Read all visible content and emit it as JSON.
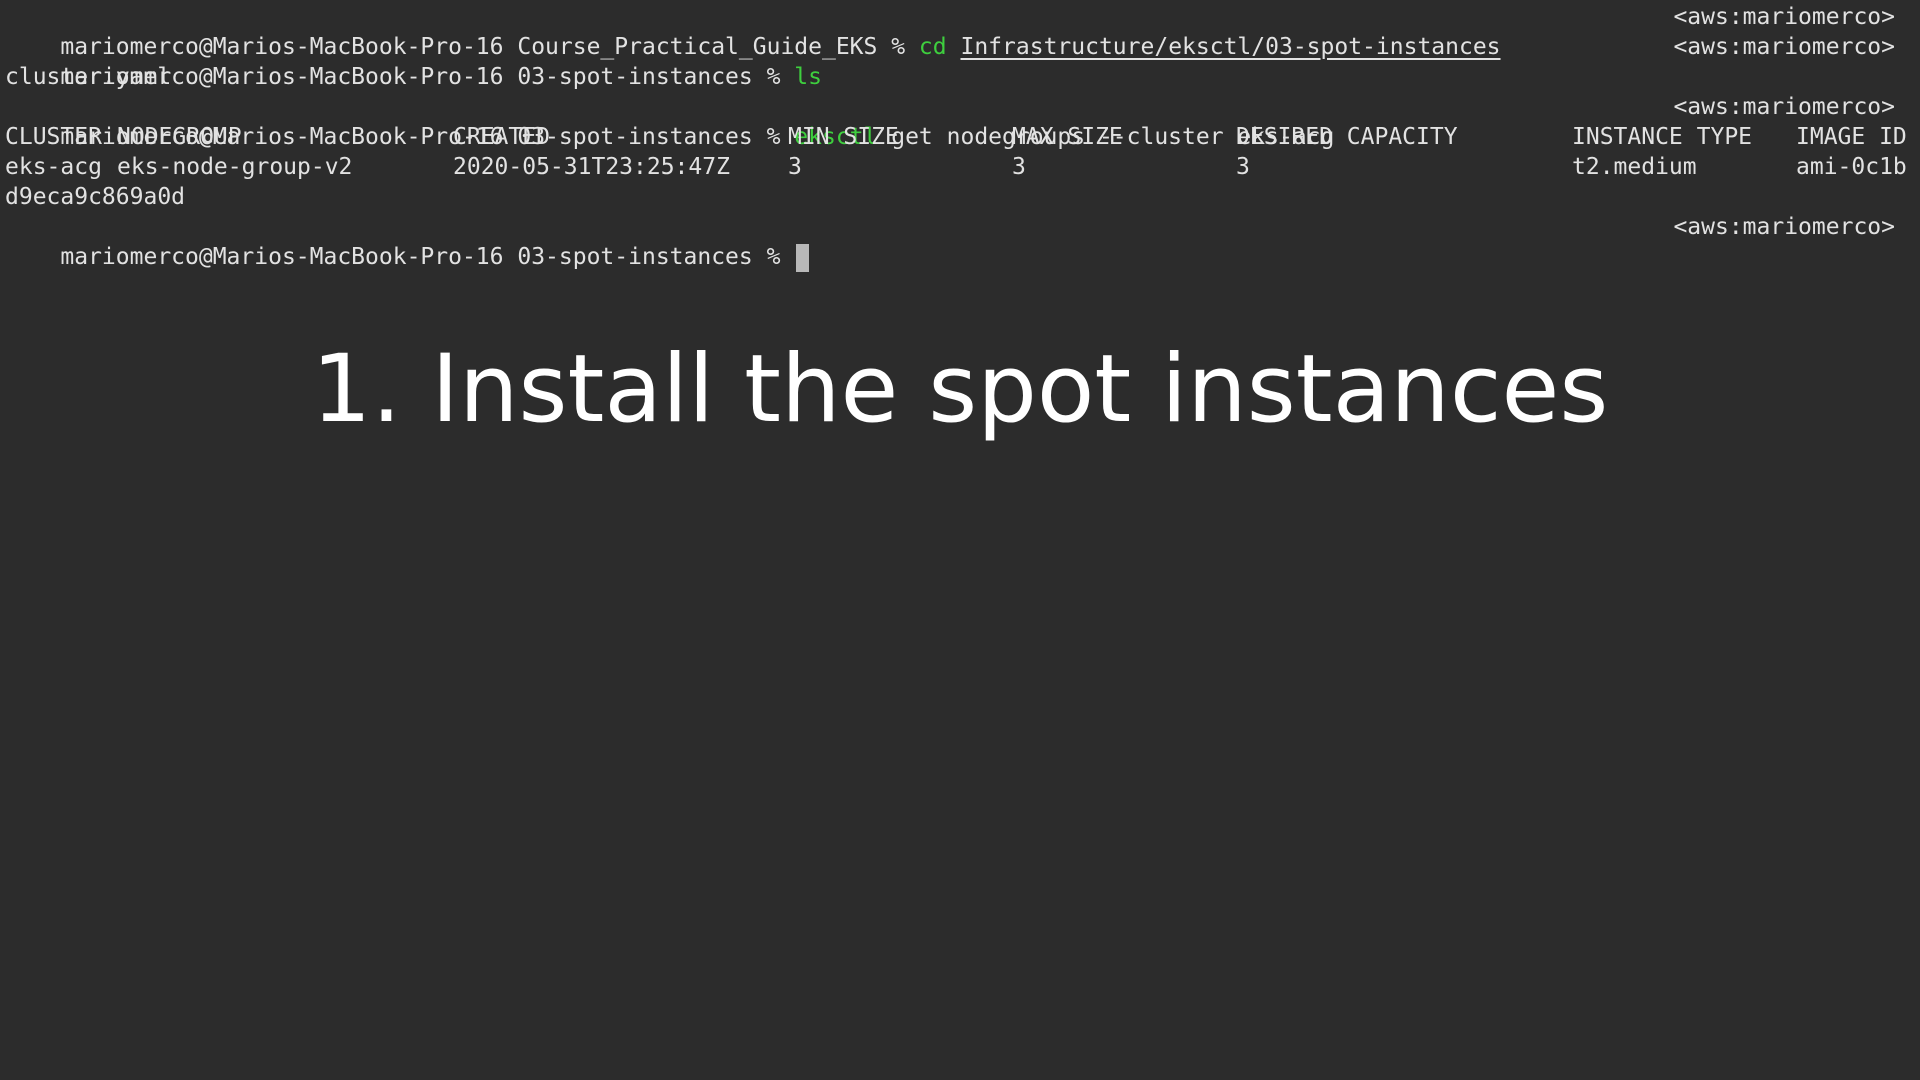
{
  "terminal": {
    "lines": [
      {
        "prompt": "mariomerco@Marios-MacBook-Pro-16 Course_Practical_Guide_EKS % ",
        "command": "cd",
        "args_underlined": "Infrastructure/eksctl/03-spot-instances",
        "right_prompt": "<aws:mariomerco>"
      },
      {
        "prompt": "mariomerco@Marios-MacBook-Pro-16 03-spot-instances % ",
        "command": "ls",
        "right_prompt": "<aws:mariomerco>"
      },
      {
        "output": "cluster.yaml"
      },
      {
        "prompt": "mariomerco@Marios-MacBook-Pro-16 03-spot-instances % ",
        "command": "eksctl",
        "args": " get nodegroups --cluster eks-acg",
        "right_prompt": "<aws:mariomerco>"
      }
    ],
    "table": {
      "headers": [
        "CLUSTER",
        "NODEGROUP",
        "CREATED",
        "MIN SIZE",
        "MAX SIZE",
        "DESIRED CAPACITY",
        "INSTANCE TYPE",
        "IMAGE ID"
      ],
      "rows": [
        [
          "eks-acg",
          "eks-node-group-v2",
          "2020-05-31T23:25:47Z",
          "3",
          "3",
          "3",
          "t2.medium",
          "ami-0c1b"
        ]
      ],
      "wrapped_continuation": "d9eca9c869a0d"
    },
    "current_prompt": {
      "prompt": "mariomerco@Marios-MacBook-Pro-16 03-spot-instances % ",
      "right_prompt": "<aws:mariomerco>"
    },
    "colors": {
      "background": "#2c2c2c",
      "text": "#e2e2e2",
      "command": "#3ecf3e"
    }
  },
  "overlay": {
    "caption": "1. Install the spot instances"
  }
}
